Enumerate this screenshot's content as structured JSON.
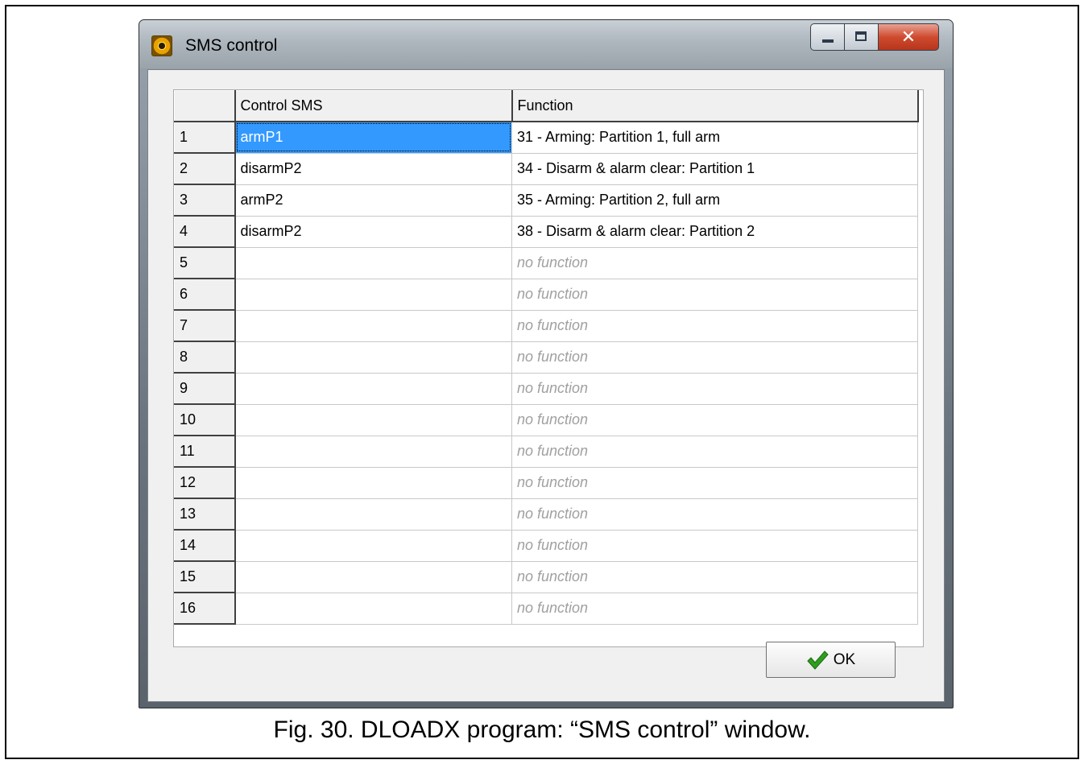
{
  "window": {
    "title": "SMS control"
  },
  "table": {
    "headers": [
      "",
      "Control SMS",
      "Function"
    ],
    "rows": [
      {
        "num": "1",
        "sms": "armP1",
        "function": "31 - Arming: Partition  1, full arm"
      },
      {
        "num": "2",
        "sms": "disarmP2",
        "function": "34 - Disarm & alarm clear: Partition  1"
      },
      {
        "num": "3",
        "sms": "armP2",
        "function": "35 - Arming: Partition  2, full arm"
      },
      {
        "num": "4",
        "sms": "disarmP2",
        "function": "38 - Disarm & alarm clear: Partition  2"
      },
      {
        "num": "5",
        "sms": "",
        "function": "no function"
      },
      {
        "num": "6",
        "sms": "",
        "function": "no function"
      },
      {
        "num": "7",
        "sms": "",
        "function": "no function"
      },
      {
        "num": "8",
        "sms": "",
        "function": "no function"
      },
      {
        "num": "9",
        "sms": "",
        "function": "no function"
      },
      {
        "num": "10",
        "sms": "",
        "function": "no function"
      },
      {
        "num": "11",
        "sms": "",
        "function": "no function"
      },
      {
        "num": "12",
        "sms": "",
        "function": "no function"
      },
      {
        "num": "13",
        "sms": "",
        "function": "no function"
      },
      {
        "num": "14",
        "sms": "",
        "function": "no function"
      },
      {
        "num": "15",
        "sms": "",
        "function": "no function"
      },
      {
        "num": "16",
        "sms": "",
        "function": "no function"
      }
    ]
  },
  "ok_button": {
    "label": "OK"
  },
  "caption": "Fig. 30. DLOADX program: “SMS control” window.",
  "colors": {
    "selection": "#3399ff",
    "no_function_text": "#a0a0a0",
    "check_icon": "#2e9e1e"
  }
}
